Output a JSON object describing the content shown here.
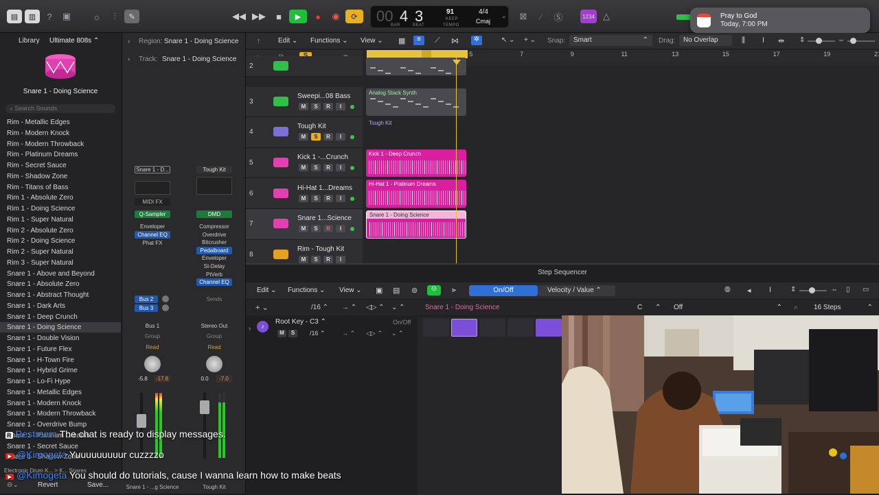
{
  "control_bar": {
    "lcd": {
      "bar": "4",
      "beat": "3",
      "bar_label": "BAR",
      "beat_label": "BEAT",
      "tempo": "91",
      "keep": "KEEP",
      "tempo_label": "TEMPO",
      "signature": "4/4",
      "key": "Cmaj"
    },
    "count_in": "1234"
  },
  "notification": {
    "title": "Pray to God",
    "time": "Today, 7:00 PM"
  },
  "library": {
    "title": "Library",
    "preset": "Ultimate 808s",
    "patch_name": "Snare 1 - Doing Science",
    "search_placeholder": "Search Sounds",
    "items": [
      "Rim - Metallic Edges",
      "Rim - Modern Knock",
      "Rim - Modern Throwback",
      "Rim - Platinum Dreams",
      "Rim - Secret Sauce",
      "Rim - Shadow Zone",
      "Rim - Titans of Bass",
      "Rim 1 - Absolute Zero",
      "Rim 1 - Doing Science",
      "Rim 1 - Super Natural",
      "Rim 2 - Absolute Zero",
      "Rim 2 - Doing Science",
      "Rim 2 - Super Natural",
      "Rim 3 - Super Natural",
      "Snare 1 - Above and Beyond",
      "Snare 1 - Absolute Zero",
      "Snare 1 - Abstract Thought",
      "Snare 1 - Dark Arts",
      "Snare 1 - Deep Crunch",
      "Snare 1 - Doing Science",
      "Snare 1 - Double Vision",
      "Snare 1 - Future Flex",
      "Snare 1 - H-Town Fire",
      "Snare 1 - Hybrid Grime",
      "Snare 1 - Lo-Fi Hype",
      "Snare 1 - Metallic Edges",
      "Snare 1 - Modern Knock",
      "Snare 1 - Modern Throwback",
      "Snare 1 - Overdrive Bump",
      "Snare 1 - Platinum Dreams",
      "Snare 1 - Secret Sauce",
      "Snare 1 - Shadow Zone"
    ],
    "selected_index": 19,
    "breadcrumb": "Electronic Drum K... > K... Snares",
    "revert": "Revert",
    "save": "Save..."
  },
  "inspector": {
    "region_label": "Region:",
    "region_name": "Snare 1 - Doing Science",
    "track_label": "Track:",
    "track_name": "Snare 1 - Doing Science",
    "strip1": {
      "setting": "Snare 1 - D...",
      "midi_fx": "MIDI FX",
      "instrument": "Q-Sampler",
      "inserts": [
        "Enveloper",
        "Channel EQ",
        "Phat FX"
      ],
      "sends": [
        "Bus 2",
        "Bus 3"
      ],
      "output": "Bus 1",
      "group": "Group",
      "auto": "Read",
      "pan_val": "-5.8",
      "peak": "-17.8",
      "name": "Snare 1 - ...g Science"
    },
    "strip2": {
      "setting": "Tough Kit",
      "instrument": "DMD",
      "inserts": [
        "Compressor",
        "Overdrive",
        "Bitcrusher",
        "Pedalboard",
        "Enveloper",
        "St-Delay",
        "PtVerb",
        "Channel EQ"
      ],
      "sends": "Sends",
      "output": "Stereo Out",
      "group": "Group",
      "auto": "Read",
      "pan_val": "0.0",
      "peak": "-7.0",
      "name": "Tough Kit"
    }
  },
  "tracks_toolbar": {
    "edit": "Edit",
    "functions": "Functions",
    "view": "View",
    "snap_label": "Snap:",
    "snap": "Smart",
    "drag_label": "Drag:",
    "drag": "No Overlap"
  },
  "ruler": [
    "1",
    "3",
    "5",
    "7",
    "9",
    "11",
    "13",
    "15",
    "17",
    "19",
    "21"
  ],
  "tracks": [
    {
      "num": "2",
      "name": "",
      "region": ""
    },
    {
      "num": "3",
      "name": "Sweepi...08 Bass",
      "region": "Analog Stack Synth"
    },
    {
      "num": "4",
      "name": "Tough Kit",
      "region": "Tough Kit"
    },
    {
      "num": "5",
      "name": "Kick 1 -...Crunch",
      "region": "Kick 1 - Deep Crunch"
    },
    {
      "num": "6",
      "name": "Hi-Hat 1...Dreams",
      "region": "Hi-Hat 1 - Platinum Dreams"
    },
    {
      "num": "7",
      "name": "Snare 1...Science",
      "region": "Snare 1 - Doing Science"
    },
    {
      "num": "8",
      "name": "Rim - Tough Kit",
      "region": ""
    }
  ],
  "step_sequencer": {
    "title": "Step Sequencer",
    "edit": "Edit",
    "functions": "Functions",
    "view": "View",
    "mode_onoff": "On/Off",
    "mode_velocity": "Velocity / Value",
    "rate": "/16",
    "pattern_name": "Snare 1 - Doing Science",
    "key": "C",
    "scale": "Off",
    "steps": "16 Steps",
    "row_name": "Root Key - C3",
    "row_onoff": "On/Off",
    "row_rate": "/16"
  },
  "chat": [
    {
      "user": "Restream",
      "text": "The chat is ready to display messages."
    },
    {
      "user": "@Kimogeta",
      "text": "Yuuuuuuuuur cuzzzzo"
    },
    {
      "user": "@Kimogeta",
      "text": "You should do tutorials, cause I wanna learn how to make beats"
    }
  ],
  "colors": {
    "region_pink": "#d91ea0",
    "playhead_yellow": "#e8c23a",
    "accent_blue": "#2f6fd6",
    "green": "#1fbf3c"
  }
}
